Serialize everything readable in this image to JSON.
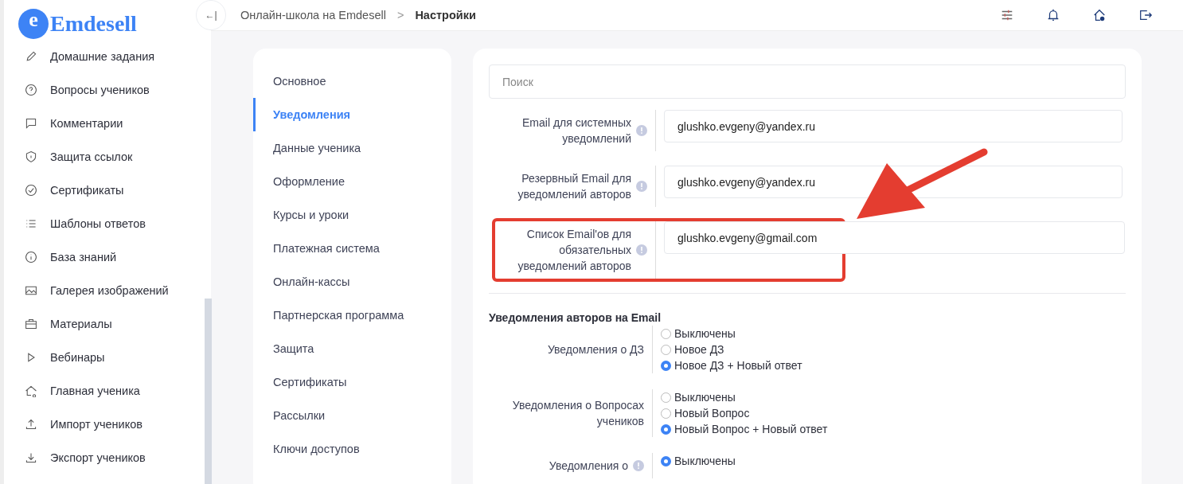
{
  "logo": {
    "letter": "e",
    "name": "Emdesell"
  },
  "sidebar": {
    "items": [
      {
        "label": "Домашние задания"
      },
      {
        "label": "Вопросы учеников"
      },
      {
        "label": "Комментарии"
      },
      {
        "label": "Защита ссылок"
      },
      {
        "label": "Сертификаты"
      },
      {
        "label": "Шаблоны ответов"
      },
      {
        "label": "База знаний"
      },
      {
        "label": "Галерея изображений"
      },
      {
        "label": "Материалы"
      },
      {
        "label": "Вебинары"
      },
      {
        "label": "Главная ученика"
      },
      {
        "label": "Импорт учеников"
      },
      {
        "label": "Экспорт учеников"
      }
    ]
  },
  "collapse_button": {
    "label": "←|"
  },
  "breadcrumb": [
    {
      "label": "Онлайн-школа на Emdesell",
      "current": false
    },
    {
      "label": "Настройки",
      "current": true
    }
  ],
  "breadcrumb_separator": ">",
  "settings_nav": [
    {
      "label": "Основное",
      "selected": false
    },
    {
      "label": "Уведомления",
      "selected": true
    },
    {
      "label": "Данные ученика",
      "selected": false
    },
    {
      "label": "Оформление",
      "selected": false
    },
    {
      "label": "Курсы и уроки",
      "selected": false
    },
    {
      "label": "Платежная система",
      "selected": false
    },
    {
      "label": "Онлайн-кассы",
      "selected": false
    },
    {
      "label": "Партнерская программа",
      "selected": false
    },
    {
      "label": "Защита",
      "selected": false
    },
    {
      "label": "Сертификаты",
      "selected": false
    },
    {
      "label": "Рассылки",
      "selected": false
    },
    {
      "label": "Ключи доступов",
      "selected": false
    }
  ],
  "search": {
    "placeholder": "Поиск"
  },
  "email_fields": [
    {
      "label": "Email для системных уведомлений",
      "value": "glushko.evgeny@yandex.ru",
      "highlighted": false
    },
    {
      "label": "Резервный Email для уведомлений авторов",
      "value": "glushko.evgeny@yandex.ru",
      "highlighted": false
    },
    {
      "label": "Список Email'ов для обязательных уведомлений авторов",
      "value": "glushko.evgeny@gmail.com",
      "highlighted": true
    }
  ],
  "section_title": "Уведомления авторов на Email",
  "radio_groups": [
    {
      "label": "Уведомления о ДЗ",
      "info": false,
      "options": [
        {
          "label": "Выключены",
          "selected": false
        },
        {
          "label": "Новое ДЗ",
          "selected": false
        },
        {
          "label": "Новое ДЗ + Новый ответ",
          "selected": true
        }
      ]
    },
    {
      "label": "Уведомления о Вопросах учеников",
      "info": false,
      "options": [
        {
          "label": "Выключены",
          "selected": false
        },
        {
          "label": "Новый Вопрос",
          "selected": false
        },
        {
          "label": "Новый Вопрос + Новый ответ",
          "selected": true
        }
      ]
    },
    {
      "label": "Уведомления о",
      "info": true,
      "options": [
        {
          "label": "Выключены",
          "selected": true
        }
      ]
    }
  ]
}
